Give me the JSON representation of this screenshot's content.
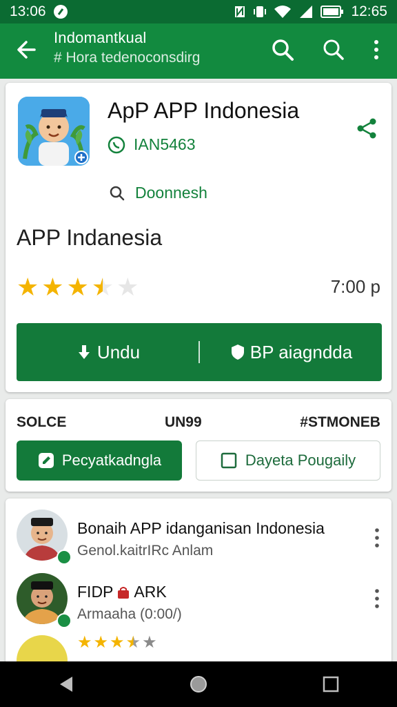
{
  "status": {
    "time_left": "13:06",
    "time_right": "12:65"
  },
  "appbar": {
    "title": "Indomantkual",
    "subtitle": "# Hora tedenoconsdirg"
  },
  "app": {
    "name": "ApP APP Indonesia",
    "dev_id": "IAN5463",
    "dev_link": "Doonnesh",
    "subtitle": "APP  Indanesia",
    "rating": 3.5,
    "time": "7:00 p"
  },
  "actions": {
    "download": "Undu",
    "secondary": "BP aiagndda"
  },
  "meta": {
    "col1": "SOLCE",
    "col2": "UN99",
    "col3": "#STMONEB"
  },
  "buttons": {
    "primary": "Pecyatkadngla",
    "secondary": "Dayeta Pougaily"
  },
  "list": [
    {
      "title": "Bonaih APP idanganisan Indonesia",
      "subtitle": "Genol.kaitrIRc Anlam"
    },
    {
      "title": "FIDP",
      "title_badge": "ARK",
      "subtitle": "Armaaha (0:00/)"
    },
    {
      "rating": 3.5
    }
  ],
  "colors": {
    "primary": "#128a3f",
    "dark": "#0b6b32",
    "star": "#f4b400"
  }
}
